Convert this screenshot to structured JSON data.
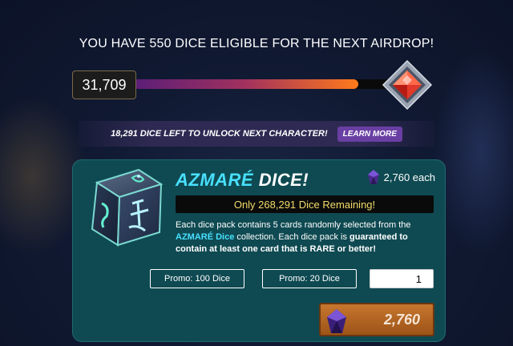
{
  "headline": "YOU HAVE 550 DICE ELIGIBLE FOR THE NEXT AIRDROP!",
  "progress": {
    "count": "31,709",
    "fill_fraction": 0.76
  },
  "unlock": {
    "text": "18,291 DICE LEFT TO UNLOCK NEXT CHARACTER!",
    "button_label": "LEARN MORE"
  },
  "pack": {
    "title_brand": "AZMARÉ",
    "title_rest": " DICE!",
    "price_each": "2,760 each",
    "remaining": "Only 268,291 Dice Remaining!",
    "desc": {
      "p1": "Each dice pack contains 5 cards randomly selected from the ",
      "brand": "AZMARÉ Dice",
      "p2": " collection. Each dice pack is ",
      "bold": "guaranteed to contain at least one card that is RARE or better!"
    },
    "promo_100": "Promo: 100 Dice",
    "promo_20": "Promo: 20 Dice",
    "quantity": "1",
    "total": "2,760"
  },
  "icons": {
    "gem": "red-diamond-gem-icon",
    "crystal": "purple-crystal-icon",
    "dice": "azmare-dice-icon"
  },
  "colors": {
    "accent_cyan": "#48e0ff",
    "remaining_yellow": "#f2dc6a",
    "card_bg": "#0f4a52",
    "buy_orange": "#c7762e",
    "learn_purple": "#6a3fa3"
  }
}
